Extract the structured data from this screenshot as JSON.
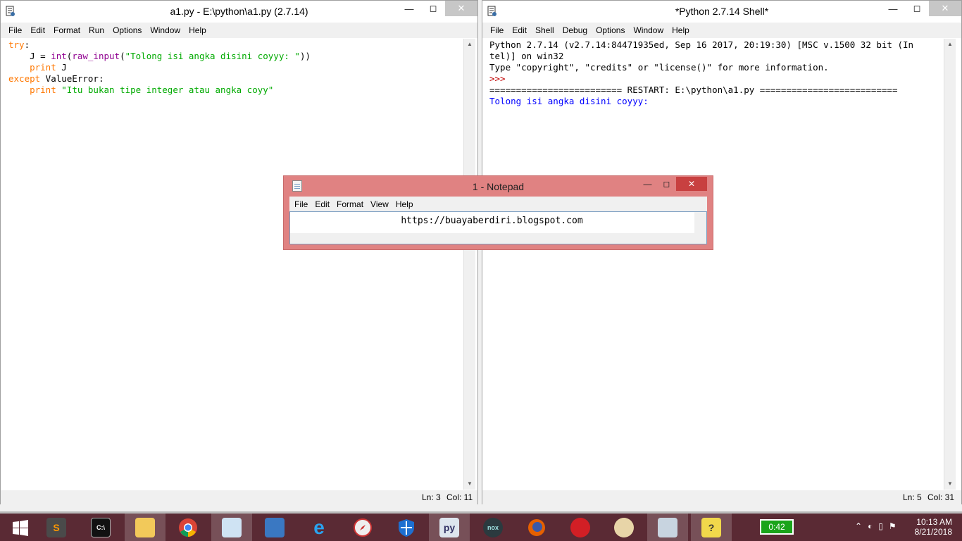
{
  "editor_window": {
    "title": "a1.py - E:\\python\\a1.py (2.7.14)",
    "menu": [
      "File",
      "Edit",
      "Format",
      "Run",
      "Options",
      "Window",
      "Help"
    ],
    "status": {
      "line": "Ln: 3",
      "col": "Col: 11"
    },
    "code": {
      "l1_kw": "try",
      "l1_rest": ":",
      "l2_pre": "    J = ",
      "l2_int": "int",
      "l2_paren": "(",
      "l2_raw": "raw_input",
      "l2_paren2": "(",
      "l2_str": "\"Tolong isi angka disini coyyy: \"",
      "l2_close": "))",
      "l3_pre": "    ",
      "l3_kw": "print",
      "l3_rest": " J",
      "l4_kw": "except",
      "l4_rest": " ValueError:",
      "l5_pre": "    ",
      "l5_kw": "print",
      "l5_sp": " ",
      "l5_str": "\"Itu bukan tipe integer atau angka coyy\""
    }
  },
  "shell_window": {
    "title": "*Python 2.7.14 Shell*",
    "menu": [
      "File",
      "Edit",
      "Shell",
      "Debug",
      "Options",
      "Window",
      "Help"
    ],
    "status": {
      "line": "Ln: 5",
      "col": "Col: 31"
    },
    "lines": {
      "l1": "Python 2.7.14 (v2.7.14:84471935ed, Sep 16 2017, 20:19:30) [MSC v.1500 32 bit (In",
      "l2": "tel)] on win32",
      "l3": "Type \"copyright\", \"credits\" or \"license()\" for more information.",
      "prompt": ">>>",
      "restart": "========================= RESTART: E:\\python\\a1.py ==========================",
      "output": "Tolong isi angka disini coyyy: "
    }
  },
  "notepad": {
    "title": "1 - Notepad",
    "menu": [
      "File",
      "Edit",
      "Format",
      "View",
      "Help"
    ],
    "content": "https://buayaberdiri.blogspot.com"
  },
  "taskbar": {
    "battery": "0:42",
    "time": "10:13 AM",
    "date": "8/21/2018",
    "apps": [
      "start-icon",
      "sublime-icon",
      "cmd-icon",
      "file-explorer-icon",
      "chrome-icon",
      "notepad-icon",
      "network-icon",
      "internet-explorer-icon",
      "compass-icon",
      "windows-defender-icon",
      "python-icon",
      "nox-icon",
      "firefox-icon",
      "garena-icon",
      "paint-icon",
      "monitor-icon",
      "help-icon"
    ],
    "colors": {
      "background": "#5a2a34",
      "battery": "#1aa41a"
    }
  }
}
